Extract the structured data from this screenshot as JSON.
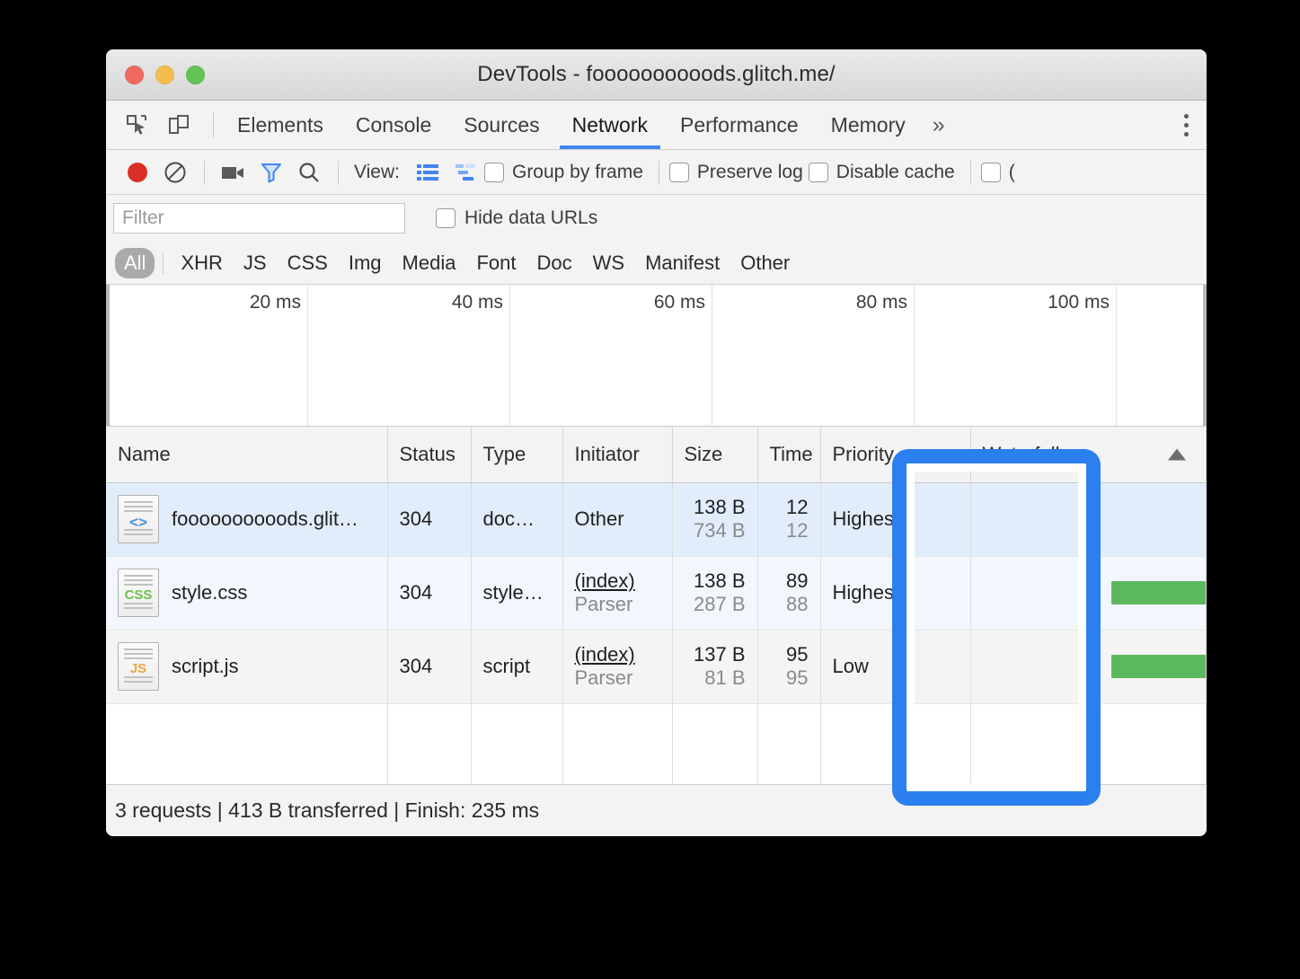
{
  "window": {
    "title": "DevTools - foooooooooods.glitch.me/",
    "traffic_lights": [
      "close",
      "minimize",
      "maximize"
    ]
  },
  "tabbar": {
    "inspect_icon": "inspect-element-icon",
    "device_icon": "device-toolbar-icon",
    "tabs": [
      {
        "label": "Elements",
        "active": false
      },
      {
        "label": "Console",
        "active": false
      },
      {
        "label": "Sources",
        "active": false
      },
      {
        "label": "Network",
        "active": true
      },
      {
        "label": "Performance",
        "active": false
      },
      {
        "label": "Memory",
        "active": false
      }
    ],
    "more_label": "»",
    "kebab_icon": "more-options-icon"
  },
  "network_toolbar": {
    "record_icon": "record-icon",
    "clear_icon": "clear-icon",
    "camera_icon": "capture-screenshots-icon",
    "filter_icon": "filter-icon",
    "search_icon": "search-icon",
    "view_label": "View:",
    "view_list_icon": "list-view-icon",
    "view_waterfall_icon": "waterfall-view-icon",
    "checkboxes": [
      {
        "label": "Group by frame",
        "checked": false
      },
      {
        "label": "Preserve log",
        "checked": false
      },
      {
        "label": "Disable cache",
        "checked": false
      },
      {
        "label": "(",
        "checked": false
      }
    ]
  },
  "filter_bar": {
    "placeholder": "Filter",
    "value": "",
    "hide_data_urls_label": "Hide data URLs",
    "hide_data_urls_checked": false
  },
  "type_filters": [
    {
      "label": "All",
      "active": true
    },
    {
      "label": "XHR",
      "active": false
    },
    {
      "label": "JS",
      "active": false
    },
    {
      "label": "CSS",
      "active": false
    },
    {
      "label": "Img",
      "active": false
    },
    {
      "label": "Media",
      "active": false
    },
    {
      "label": "Font",
      "active": false
    },
    {
      "label": "Doc",
      "active": false
    },
    {
      "label": "WS",
      "active": false
    },
    {
      "label": "Manifest",
      "active": false
    },
    {
      "label": "Other",
      "active": false
    }
  ],
  "overview": {
    "ticks": [
      "20 ms",
      "40 ms",
      "60 ms",
      "80 ms",
      "100 ms"
    ]
  },
  "table": {
    "columns": [
      "Name",
      "Status",
      "Type",
      "Initiator",
      "Size",
      "Time",
      "Priority",
      "Waterfall"
    ],
    "sort_indicator": "ascending",
    "rows": [
      {
        "icon": "html-file-icon",
        "glyph": "<>",
        "name": "foooooooooods.glit…",
        "status": "304",
        "type": "doc…",
        "initiator": "Other",
        "initiator_sub": "",
        "size": "138 B",
        "size_sub": "734 B",
        "time": "12",
        "time_sub": "12",
        "priority": "Highest",
        "waterfall_bar": false
      },
      {
        "icon": "css-file-icon",
        "glyph": "CSS",
        "name": "style.css",
        "status": "304",
        "type": "style…",
        "initiator": "(index)",
        "initiator_sub": "Parser",
        "size": "138 B",
        "size_sub": "287 B",
        "time": "89",
        "time_sub": "88",
        "priority": "Highest",
        "waterfall_bar": true
      },
      {
        "icon": "js-file-icon",
        "glyph": "JS",
        "name": "script.js",
        "status": "304",
        "type": "script",
        "initiator": "(index)",
        "initiator_sub": "Parser",
        "size": "137 B",
        "size_sub": "81 B",
        "time": "95",
        "time_sub": "95",
        "priority": "Low",
        "waterfall_bar": true
      }
    ]
  },
  "status_bar": {
    "text": "3 requests | 413 B transferred | Finish: 235 ms"
  },
  "annotation": {
    "target": "priority-column",
    "color": "#2b7fef"
  }
}
